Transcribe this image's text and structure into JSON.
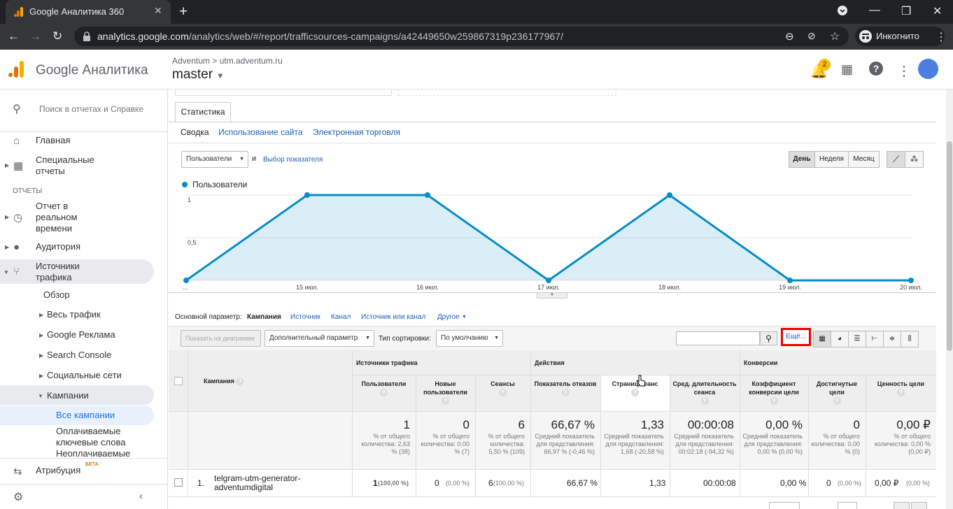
{
  "browser": {
    "tab_title": "Google Аналитика 360",
    "url_domain": "analytics.google.com",
    "url_path": "/analytics/web/#/report/trafficsources-campaigns/a42449650w259867319p236177967/",
    "incognito_label": "Инкогнито"
  },
  "header": {
    "product": "Google Аналитика",
    "breadcrumb": "Adventum > utm.adventum.ru",
    "view": "master",
    "notifications": "2"
  },
  "sidebar": {
    "search_placeholder": "Поиск в отчетах и Справке",
    "home": "Главная",
    "custom": "Специальные отчеты",
    "reports_header": "ОТЧЕТЫ",
    "realtime": "Отчет в реальном времени",
    "audience": "Аудитория",
    "acquisition": "Источники трафика",
    "overview": "Обзор",
    "all_traffic": "Весь трафик",
    "google_ads": "Google Реклама",
    "search_console": "Search Console",
    "social": "Социальные сети",
    "campaigns": "Кампании",
    "all_campaigns": "Все кампании",
    "paid_keywords": "Оплачиваемые ключевые слова",
    "unpaid": "Неоплачиваемые",
    "attribution": "Атрибуция",
    "beta": "БЕТА"
  },
  "report": {
    "tab": "Статистика",
    "subtabs": [
      "Сводка",
      "Использование сайта",
      "Электронная торговля"
    ],
    "metric_select": "Пользователи",
    "and": "и",
    "choose_metric": "Выбор показателя",
    "periods": [
      "День",
      "Неделя",
      "Месяц"
    ],
    "primary_dim_label": "Основной параметр:",
    "dims": [
      "Кампания",
      "Источник",
      "Канал",
      "Источник или канал",
      "Другое"
    ],
    "plot_rows": "Показать на диаграмме",
    "secondary_dim": "Дополнительный параметр",
    "sort_label": "Тип сортировки:",
    "sort_value": "По умолчанию",
    "more_link": "Ещё..."
  },
  "chart_data": {
    "type": "area",
    "legend": "Пользователи",
    "x": [
      "...",
      "15 июл.",
      "16 июл.",
      "17 июл.",
      "18 июл.",
      "19 июл.",
      "20 июл."
    ],
    "series": [
      {
        "name": "Пользователи",
        "values": [
          0,
          1,
          1,
          0,
          1,
          0,
          0
        ]
      }
    ],
    "yticks": [
      "1",
      "0,5"
    ],
    "ylim": [
      0,
      1.2
    ],
    "color": "#058dc7"
  },
  "table": {
    "group_headers": [
      "Источники трафика",
      "Действия",
      "Конверсии"
    ],
    "first_col": "Кампания",
    "columns": [
      {
        "label": "Пользователи",
        "total": "1",
        "sub": "% от общего количества: 2,63 % (38)"
      },
      {
        "label": "Новые пользователи",
        "total": "0",
        "sub": "% от общего количества: 0,00 % (7)"
      },
      {
        "label": "Сеансы",
        "total": "6",
        "sub": "% от общего количества: 5,50 % (109)"
      },
      {
        "label": "Показатель отказов",
        "total": "66,67 %",
        "sub": "Средний показатель для представления: 66,97 % (-0,46 %)"
      },
      {
        "label": "Страниц/сеанс",
        "total": "1,33",
        "sub": "Средний показатель для представления: 1,68 (-20,58 %)"
      },
      {
        "label": "Сред. длительность сеанса",
        "total": "00:00:08",
        "sub": "Средний показатель для представления: 00:02:18 (-94,32 %)"
      },
      {
        "label": "Коэффициент конверсии цели",
        "total": "0,00 %",
        "sub": "Средний показатель для представления: 0,00 % (0,00 %)"
      },
      {
        "label": "Достигнутые цели",
        "total": "0",
        "sub": "% от общего количества: 0,00 % (0)"
      },
      {
        "label": "Ценность цели",
        "total": "0,00 ₽",
        "sub": "% от общего количества: 0,00 % (0,00 ₽)"
      }
    ],
    "row": {
      "index": "1.",
      "campaign": "telgram-utm-generator-adventumdigital",
      "users": "1",
      "users_pct": "(100,00 %)",
      "new_users": "0",
      "new_users_pct": "(0,00 %)",
      "sessions": "6",
      "sessions_pct": "(100,00 %)",
      "bounce": "66,67 %",
      "pages": "1,33",
      "duration": "00:00:08",
      "conv": "0,00 %",
      "goals": "0",
      "goals_pct": "(0,00 %)",
      "value": "0,00 ₽",
      "value_pct": "(0,00 %)"
    }
  }
}
